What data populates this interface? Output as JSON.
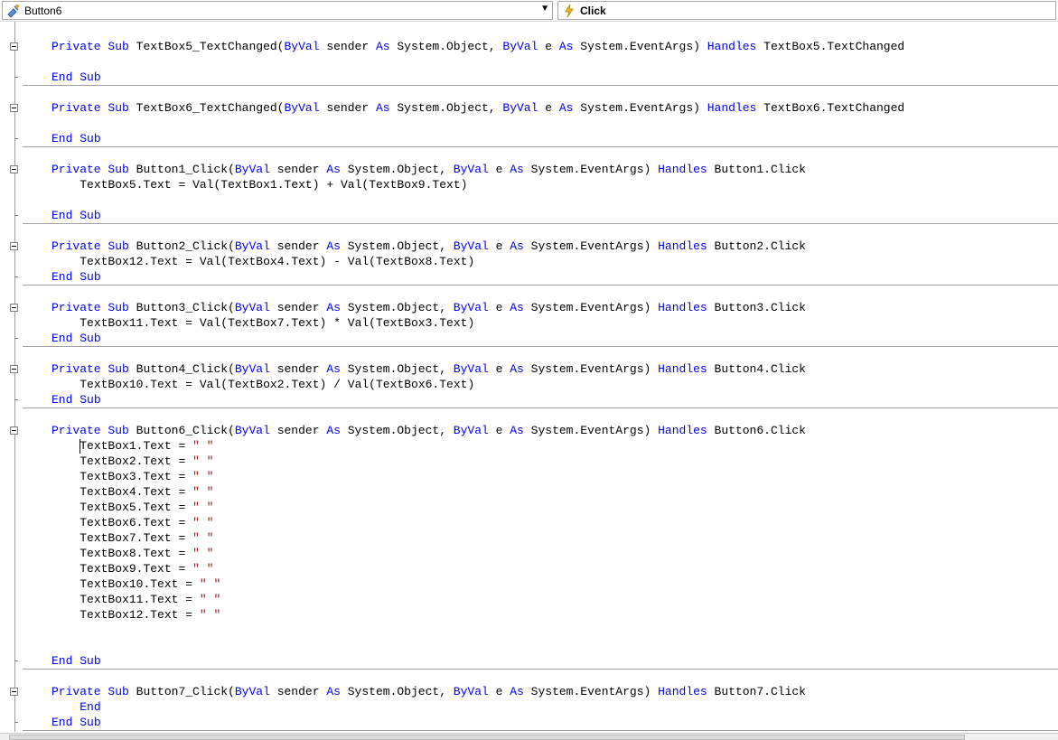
{
  "object_combo": {
    "value": "Button6",
    "icon": "class-icon"
  },
  "event_combo": {
    "value": "Click",
    "icon": "lightning-icon"
  },
  "code": [
    {
      "line": "Private Sub TextBox5_TextChanged(ByVal sender As System.Object, ByVal e As System.EventArgs) Handles TextBox5.TextChanged"
    },
    {
      "line": ""
    },
    {
      "line": "End Sub"
    },
    {
      "line": "Private Sub TextBox6_TextChanged(ByVal sender As System.Object, ByVal e As System.EventArgs) Handles TextBox6.TextChanged"
    },
    {
      "line": ""
    },
    {
      "line": "End Sub"
    },
    {
      "line": "Private Sub Button1_Click(ByVal sender As System.Object, ByVal e As System.EventArgs) Handles Button1.Click"
    },
    {
      "line": "    TextBox5.Text = Val(TextBox1.Text) + Val(TextBox9.Text)"
    },
    {
      "line": ""
    },
    {
      "line": "End Sub"
    },
    {
      "line": "Private Sub Button2_Click(ByVal sender As System.Object, ByVal e As System.EventArgs) Handles Button2.Click"
    },
    {
      "line": "    TextBox12.Text = Val(TextBox4.Text) - Val(TextBox8.Text)"
    },
    {
      "line": "End Sub"
    },
    {
      "line": "Private Sub Button3_Click(ByVal sender As System.Object, ByVal e As System.EventArgs) Handles Button3.Click"
    },
    {
      "line": "    TextBox11.Text = Val(TextBox7.Text) * Val(TextBox3.Text)"
    },
    {
      "line": "End Sub"
    },
    {
      "line": "Private Sub Button4_Click(ByVal sender As System.Object, ByVal e As System.EventArgs) Handles Button4.Click"
    },
    {
      "line": "    TextBox10.Text = Val(TextBox2.Text) / Val(TextBox6.Text)"
    },
    {
      "line": "End Sub"
    },
    {
      "line": "Private Sub Button6_Click(ByVal sender As System.Object, ByVal e As System.EventArgs) Handles Button6.Click"
    },
    {
      "line": "    TextBox1.Text = \" \""
    },
    {
      "line": "    TextBox2.Text = \" \""
    },
    {
      "line": "    TextBox3.Text = \" \""
    },
    {
      "line": "    TextBox4.Text = \" \""
    },
    {
      "line": "    TextBox5.Text = \" \""
    },
    {
      "line": "    TextBox6.Text = \" \""
    },
    {
      "line": "    TextBox7.Text = \" \""
    },
    {
      "line": "    TextBox8.Text = \" \""
    },
    {
      "line": "    TextBox9.Text = \" \""
    },
    {
      "line": "    TextBox10.Text = \" \""
    },
    {
      "line": "    TextBox11.Text = \" \""
    },
    {
      "line": "    TextBox12.Text = \" \""
    },
    {
      "line": ""
    },
    {
      "line": ""
    },
    {
      "line": "End Sub"
    },
    {
      "line": "Private Sub Button7_Click(ByVal sender As System.Object, ByVal e As System.EventArgs) Handles Button7.Click"
    },
    {
      "line": "    End"
    },
    {
      "line": "End Sub"
    }
  ],
  "keywords": [
    "Private",
    "Sub",
    "ByVal",
    "As",
    "Handles",
    "End"
  ],
  "colors": {
    "keyword": "#0000ff",
    "string": "#a31515",
    "text": "#000000",
    "separator": "#a0a0a0"
  }
}
